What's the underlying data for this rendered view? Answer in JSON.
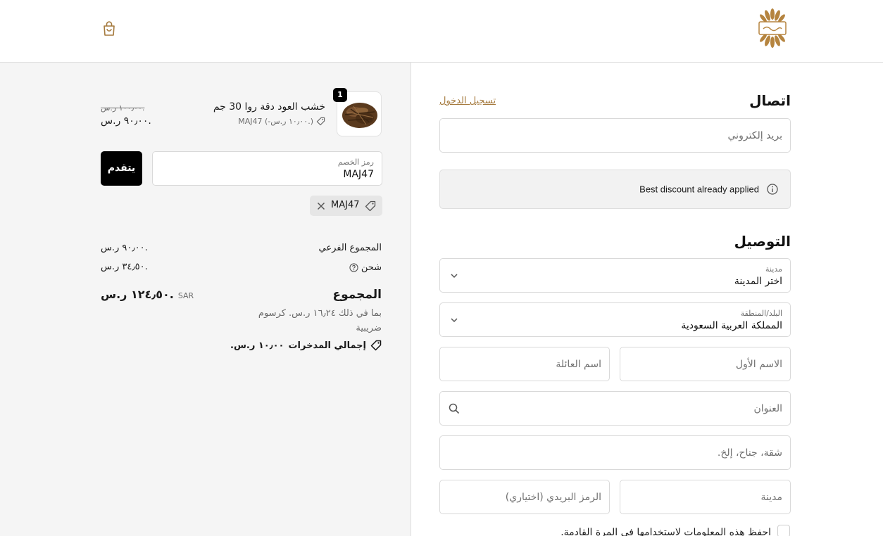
{
  "header": {
    "logo_icon": "brand-logo-icon",
    "cart_icon": "shopping-bag-icon",
    "accent_color": "#a57a3e"
  },
  "contact": {
    "heading": "اتصال",
    "login_link": "تسجيل الدخول",
    "email_placeholder": "بريد إلكتروني",
    "discount_notice": "Best discount already applied"
  },
  "delivery": {
    "heading": "التوصيل",
    "city_select": {
      "label": "مدينة",
      "value": "اختر المدينة"
    },
    "country_select": {
      "label": "البلد/المنطقة",
      "value": "المملكة العربية السعودية"
    },
    "first_name_placeholder": "الاسم الأول",
    "last_name_placeholder": "اسم العائلة",
    "address_placeholder": "العنوان",
    "apartment_placeholder": "شقة، جناح، إلخ.",
    "city_placeholder": "مدينة",
    "postal_placeholder": "الرمز البريدي (اختياري)",
    "save_info_label": "احفظ هذه المعلومات لاستخدامها في المرة القادمة."
  },
  "summary": {
    "item": {
      "quantity": "1",
      "name": "خشب العود دقة روا 30 جم",
      "discount_line": "MAJ47 (-١٠٫٠٠ ر.س.)",
      "original_price": "١٠٠٫٠٠ ر.س.",
      "price": "٩٠٫٠٠ ر.س."
    },
    "discount_field": {
      "label": "رمز الخصم",
      "value": "MAJ47"
    },
    "apply_button": "يتقدم",
    "applied_code": "MAJ47",
    "subtotal_label": "المجموع الفرعي",
    "subtotal_value": "٩٠٫٠٠ ر.س.",
    "shipping_label": "شحن",
    "shipping_value": "٣٤٫٥٠ ر.س.",
    "total_label": "المجموع",
    "currency": "SAR",
    "total_value": "١٢٤٫٥٠ ر.س.",
    "tax_note": "بما في ذلك ١٦٫٢٤ ر.س. كرسوم ضريبية",
    "savings_label": "إجمالي المدخرات",
    "savings_value": "١٠٫٠٠ ر.س."
  }
}
